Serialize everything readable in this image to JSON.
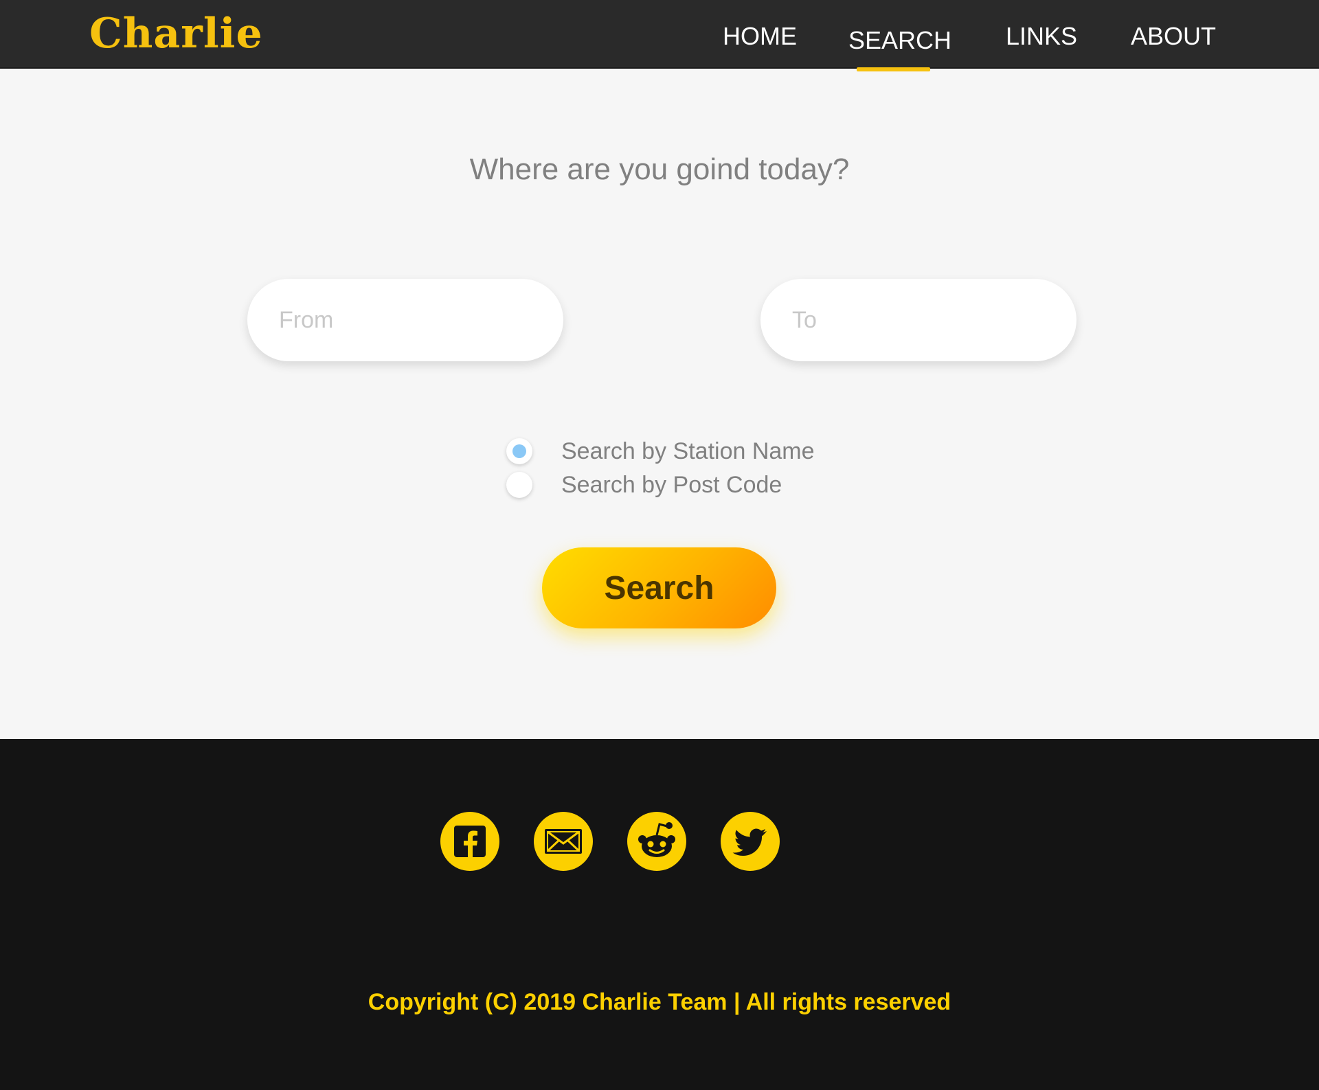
{
  "brand": {
    "name": "Charlie",
    "color": "#f6c10f"
  },
  "nav": {
    "items": [
      {
        "label": "HOME",
        "active": false
      },
      {
        "label": "SEARCH",
        "active": true
      },
      {
        "label": "LINKS",
        "active": false
      },
      {
        "label": "ABOUT",
        "active": false
      }
    ]
  },
  "main": {
    "heading": "Where are you goind today?",
    "from": {
      "placeholder": "From",
      "value": ""
    },
    "to": {
      "placeholder": "To",
      "value": ""
    },
    "search_mode": {
      "options": [
        {
          "label": "Search by Station Name",
          "checked": true
        },
        {
          "label": "Search by Post Code",
          "checked": false
        }
      ]
    },
    "search_button": "Search"
  },
  "footer": {
    "social": [
      {
        "icon": "facebook-icon"
      },
      {
        "icon": "mail-icon"
      },
      {
        "icon": "reddit-icon"
      },
      {
        "icon": "twitter-icon"
      }
    ],
    "copyright": "Copyright (C) 2019 Charlie Team | All rights reserved",
    "accent": "#fcd000"
  }
}
